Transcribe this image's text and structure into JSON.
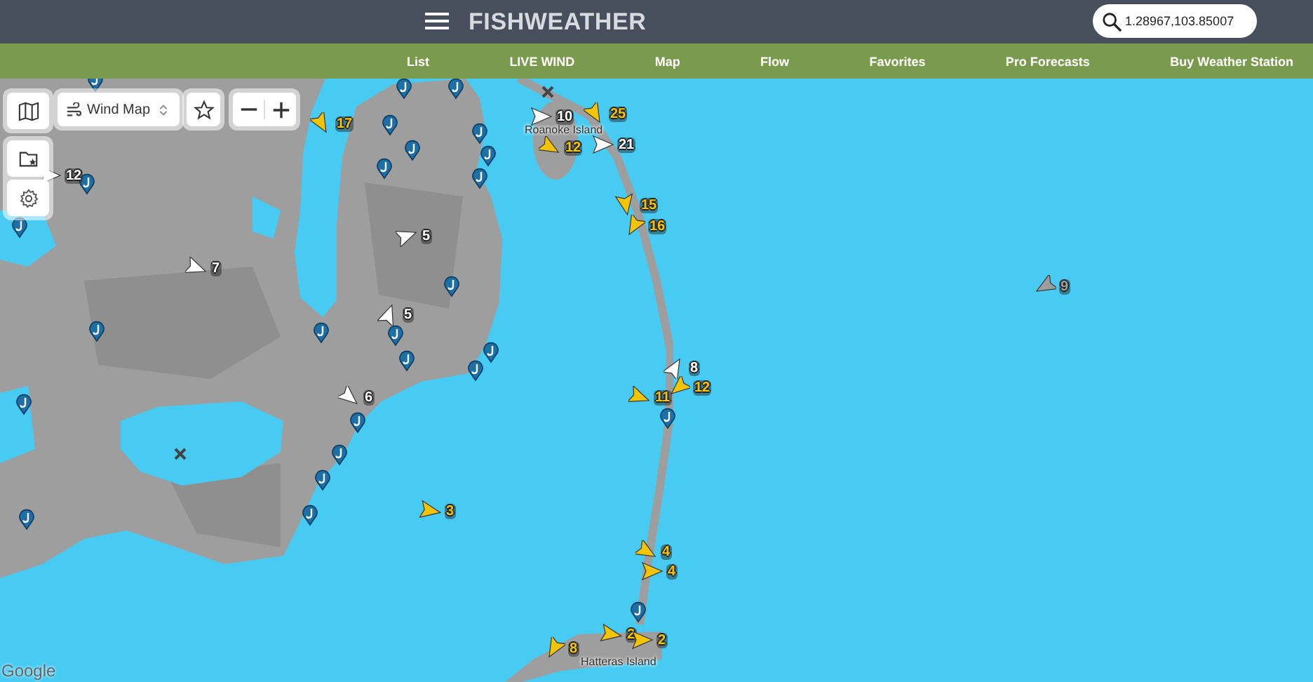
{
  "header": {
    "logo": "FISHWEATHER",
    "search": {
      "value": "1.28967,103.85007"
    }
  },
  "nav": [
    "List",
    "LIVE WIND",
    "Map",
    "Flow",
    "Favorites",
    "Pro Forecasts",
    "Buy Weather Station"
  ],
  "map_controls": {
    "layer_select": "Wind Map"
  },
  "map_labels": [
    "Roanoke Island",
    "Hatteras Island"
  ],
  "wind_markers": [
    {
      "speed": "17",
      "color": "#f5c400"
    },
    {
      "speed": "10",
      "color": "#ffffff"
    },
    {
      "speed": "25",
      "color": "#f5c400"
    },
    {
      "speed": "12",
      "color": "#f5c400"
    },
    {
      "speed": "21",
      "color": "#ffffff"
    },
    {
      "speed": "12",
      "color": "#ffffff"
    },
    {
      "speed": "15",
      "color": "#f5c400"
    },
    {
      "speed": "16",
      "color": "#f5c400"
    },
    {
      "speed": "5",
      "color": "#ffffff"
    },
    {
      "speed": "7",
      "color": "#ffffff"
    },
    {
      "speed": "5",
      "color": "#ffffff"
    },
    {
      "speed": "9",
      "color": "#9e9e9e"
    },
    {
      "speed": "8",
      "color": "#ffffff"
    },
    {
      "speed": "6",
      "color": "#ffffff"
    },
    {
      "speed": "11",
      "color": "#f5c400"
    },
    {
      "speed": "12",
      "color": "#f5c400"
    },
    {
      "speed": "3",
      "color": "#f5c400"
    },
    {
      "speed": "4",
      "color": "#f5c400"
    },
    {
      "speed": "4",
      "color": "#f5c400"
    },
    {
      "speed": "8",
      "color": "#f5c400"
    },
    {
      "speed": "2",
      "color": "#f5c400"
    },
    {
      "speed": "2",
      "color": "#f5c400"
    }
  ],
  "attribution": "Google"
}
